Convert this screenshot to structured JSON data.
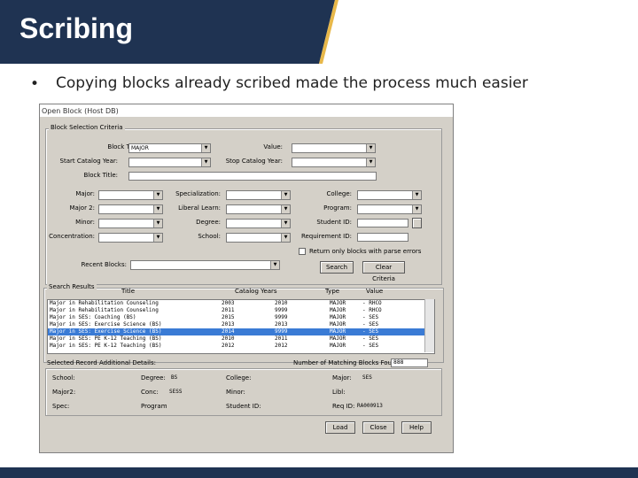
{
  "slide": {
    "title": "Scribing",
    "bullet": "Copying blocks already scribed made the process much easier",
    "colors": {
      "banner": "#1f3352",
      "accent": "#e8b84a"
    }
  },
  "dialog": {
    "title": "Open Block (Host DB)",
    "criteria": {
      "group_label": "Block Selection Criteria",
      "block_type_label": "Block Type:",
      "block_type_value": "MAJOR",
      "value_label": "Value:",
      "start_year_label": "Start Catalog Year:",
      "stop_year_label": "Stop Catalog Year:",
      "block_title_label": "Block Title:",
      "major_label": "Major:",
      "major2_label": "Major 2:",
      "minor_label": "Minor:",
      "concentration_label": "Concentration:",
      "specialization_label": "Specialization:",
      "liberal_learn_label": "Liberal Learn:",
      "degree_label": "Degree:",
      "school_label": "School:",
      "college_label": "College:",
      "program_label": "Program:",
      "student_id_label": "Student ID:",
      "requirement_id_label": "Requirement ID:",
      "parse_errors_label": "Return only blocks with parse errors",
      "recent_blocks_label": "Recent Blocks:",
      "search_button": "Search",
      "clear_button": "Clear Criteria"
    },
    "results": {
      "group_label": "Search Results",
      "headers": {
        "title": "Title",
        "catalog_years": "Catalog Years",
        "type": "Type",
        "value": "Value"
      },
      "rows": [
        {
          "title": "Major in Rehabilitation Counseling",
          "start": "2003",
          "end": "2010",
          "type": "MAJOR",
          "value": "- RHCO"
        },
        {
          "title": "Major in Rehabilitation Counseling",
          "start": "2011",
          "end": "9999",
          "type": "MAJOR",
          "value": "- RHCO"
        },
        {
          "title": "Major in SES: Coaching (BS)",
          "start": "2015",
          "end": "9999",
          "type": "MAJOR",
          "value": "- SES"
        },
        {
          "title": "Major in SES: Exercise Science (BS)",
          "start": "2013",
          "end": "2013",
          "type": "MAJOR",
          "value": "- SES"
        },
        {
          "title": "Major in SES: Exercise Science (BS)",
          "start": "2014",
          "end": "9999",
          "type": "MAJOR",
          "value": "- SES"
        },
        {
          "title": "Major in SES: PE K-12 Teaching (BS)",
          "start": "2010",
          "end": "2011",
          "type": "MAJOR",
          "value": "- SES"
        },
        {
          "title": "Major in SES: PE K-12 Teaching (BS)",
          "start": "2012",
          "end": "2012",
          "type": "MAJOR",
          "value": "- SES"
        }
      ],
      "selected_index": 4,
      "selected_details_label": "Selected Record Additional Details:",
      "matching_label": "Number of Matching Blocks Found:",
      "matching_count": "888"
    },
    "details": {
      "school_label": "School:",
      "degree_label": "Degree:",
      "degree_value": "BS",
      "college_label": "College:",
      "major_label": "Major:",
      "major_value": "SES",
      "major2_label": "Major2:",
      "conc_label": "Conc:",
      "conc_value": "SESS",
      "minor_label": "Minor:",
      "libl_label": "Libl:",
      "spec_label": "Spec:",
      "program_label": "Program",
      "student_id_label": "Student ID:",
      "req_id_label": "Req ID:",
      "req_id_value": "RA000913"
    },
    "buttons": {
      "load": "Load",
      "close": "Close",
      "help": "Help"
    }
  }
}
